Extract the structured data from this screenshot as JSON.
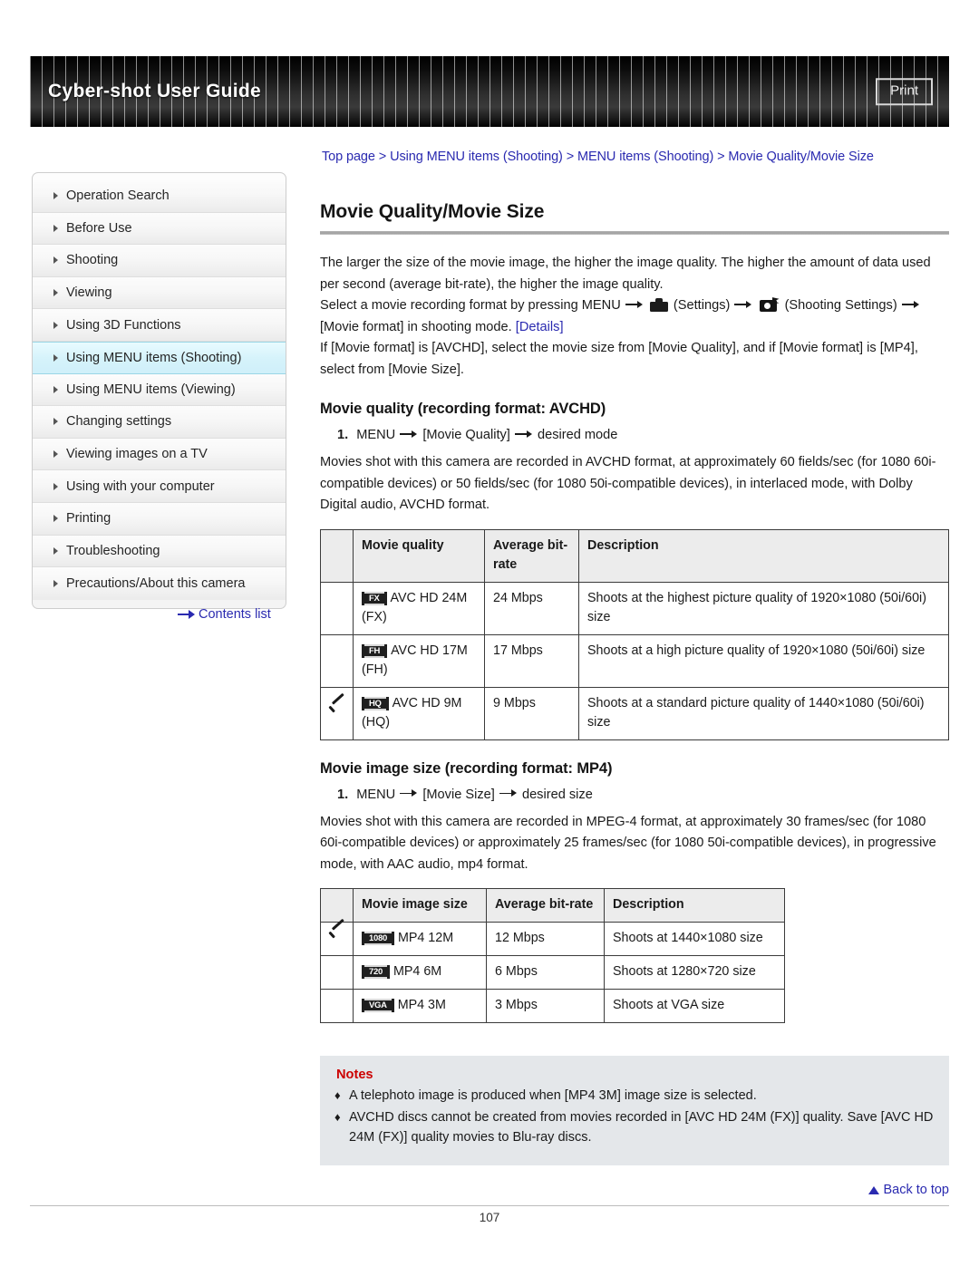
{
  "header": {
    "title": "Cyber-shot User Guide",
    "print_label": "Print"
  },
  "breadcrumb": {
    "text": "Top page > Using MENU items (Shooting) > MENU items (Shooting) > Movie Quality/Movie Size"
  },
  "sidebar": {
    "items": [
      {
        "label": "Operation Search",
        "active": false
      },
      {
        "label": "Before Use",
        "active": false
      },
      {
        "label": "Shooting",
        "active": false
      },
      {
        "label": "Viewing",
        "active": false
      },
      {
        "label": "Using 3D Functions",
        "active": false
      },
      {
        "label": "Using MENU items (Shooting)",
        "active": true
      },
      {
        "label": "Using MENU items (Viewing)",
        "active": false
      },
      {
        "label": "Changing settings",
        "active": false
      },
      {
        "label": "Viewing images on a TV",
        "active": false
      },
      {
        "label": "Using with your computer",
        "active": false
      },
      {
        "label": "Printing",
        "active": false
      },
      {
        "label": "Troubleshooting",
        "active": false
      },
      {
        "label": "Precautions/About this camera",
        "active": false
      }
    ],
    "contents_list_label": "Contents list"
  },
  "main": {
    "page_title": "Movie Quality/Movie Size",
    "intro": {
      "line1": "The larger the size of the movie image, the higher the image quality. The higher the amount of data used per second (average bit-rate), the higher the image quality.",
      "line2_a": "Select a movie recording format by pressing MENU",
      "line2_b": "(Settings)",
      "line2_c": "(Shooting Settings)",
      "line2_d": "[Movie format] in shooting mode.",
      "details_link": "[Details]",
      "line3": "If [Movie format] is [AVCHD], select the movie size from [Movie Quality], and if [Movie format] is [MP4], select from [Movie Size]."
    },
    "avchd_section": {
      "heading": "Movie quality (recording format: AVCHD)",
      "step_number": "1.",
      "step_a": "MENU",
      "step_b": "[Movie Quality]",
      "step_c": "desired mode",
      "paragraph": "Movies shot with this camera are recorded in AVCHD format, at approximately 60 fields/sec (for 1080 60i-compatible devices) or 50 fields/sec (for 1080 50i-compatible devices), in interlaced mode, with Dolby Digital audio, AVCHD format."
    },
    "avchd_table": {
      "headers": [
        "",
        "Movie quality",
        "Average bit-rate",
        "Description"
      ],
      "rows": [
        {
          "checked": false,
          "badge": "FX",
          "quality": "AVC HD 24M (FX)",
          "bitrate": "24 Mbps",
          "description": "Shoots at the highest picture quality of 1920×1080 (50i/60i) size"
        },
        {
          "checked": false,
          "badge": "FH",
          "quality": "AVC HD 17M (FH)",
          "bitrate": "17 Mbps",
          "description": "Shoots at a high picture quality of 1920×1080 (50i/60i) size"
        },
        {
          "checked": true,
          "badge": "HQ",
          "quality": "AVC HD 9M (HQ)",
          "bitrate": "9 Mbps",
          "description": "Shoots at a standard picture quality of 1440×1080 (50i/60i) size"
        }
      ]
    },
    "mp4_section": {
      "heading": "Movie image size (recording format: MP4)",
      "step_number": "1.",
      "step_a": "MENU",
      "step_b": "[Movie Size]",
      "step_c": "desired size",
      "paragraph": "Movies shot with this camera are recorded in MPEG-4 format, at approximately 30 frames/sec (for 1080 60i-compatible devices) or approximately 25 frames/sec (for 1080 50i-compatible devices), in progressive mode, with AAC audio, mp4 format."
    },
    "mp4_table": {
      "headers": [
        "",
        "Movie image size",
        "Average bit-rate",
        "Description"
      ],
      "rows": [
        {
          "checked": true,
          "badge": "1080",
          "size": "MP4 12M",
          "bitrate": "12 Mbps",
          "description": "Shoots at 1440×1080 size"
        },
        {
          "checked": false,
          "badge": "720",
          "size": "MP4 6M",
          "bitrate": "6 Mbps",
          "description": "Shoots at 1280×720 size"
        },
        {
          "checked": false,
          "badge": "VGA",
          "size": "MP4 3M",
          "bitrate": "3 Mbps",
          "description": "Shoots at VGA size"
        }
      ]
    },
    "notes": {
      "heading": "Notes",
      "items": [
        "A telephoto image is produced when [MP4 3M] image size is selected.",
        "AVCHD discs cannot be created from movies recorded in [AVC HD 24M (FX)] quality. Save [AVC HD 24M (FX)] quality movies to Blu-ray discs."
      ]
    }
  },
  "footer": {
    "back_to_top_label": "Back to top",
    "page_number": "107"
  },
  "colors": {
    "link": "#2a2ab0",
    "notes_heading": "#cc0000",
    "active_nav": "#d6f3fb",
    "table_header_bg": "#ececec",
    "notes_bg": "#e4e7ea"
  }
}
